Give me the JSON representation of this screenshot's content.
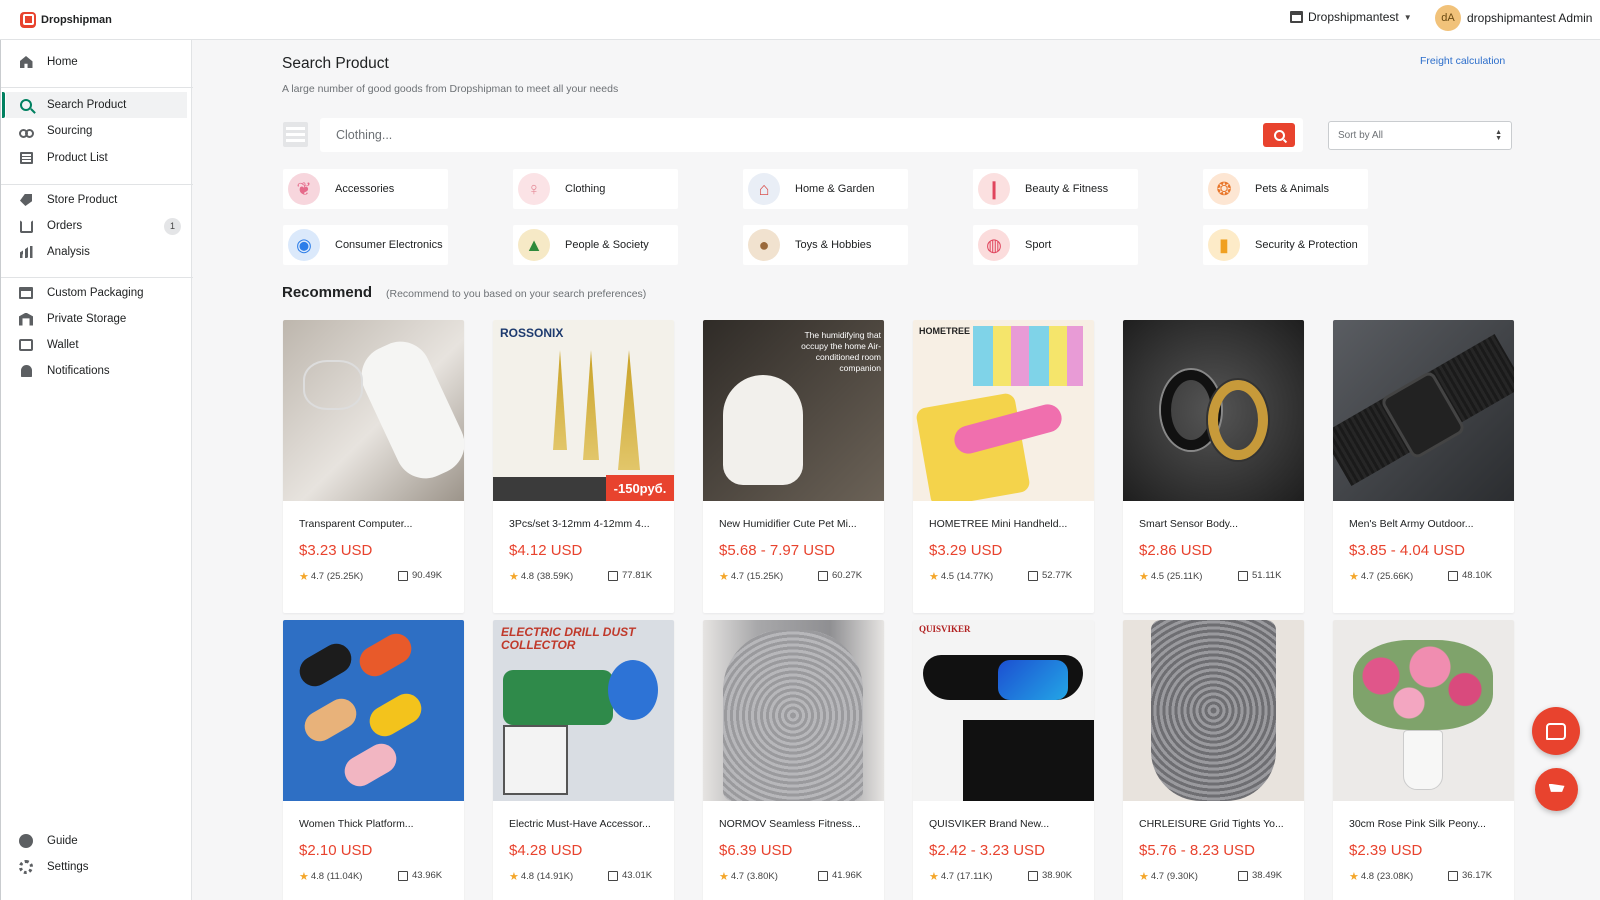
{
  "app": {
    "logo_text": "Dropshipman"
  },
  "header": {
    "store_name": "Dropshipmantest",
    "avatar_initials": "dA",
    "user_name": "dropshipmantest Admin"
  },
  "sidebar": {
    "items": [
      {
        "key": "home",
        "label": "Home",
        "icon": "home-icon"
      },
      {
        "key": "search",
        "label": "Search Product",
        "icon": "search-icon",
        "active": true
      },
      {
        "key": "sourcing",
        "label": "Sourcing",
        "icon": "glasses-icon"
      },
      {
        "key": "productlist",
        "label": "Product List",
        "icon": "list-icon"
      },
      {
        "key": "store",
        "label": "Store Product",
        "icon": "tag-icon"
      },
      {
        "key": "orders",
        "label": "Orders",
        "icon": "orders-icon",
        "badge": "1"
      },
      {
        "key": "analysis",
        "label": "Analysis",
        "icon": "bar-chart-icon"
      },
      {
        "key": "packaging",
        "label": "Custom Packaging",
        "icon": "box-icon"
      },
      {
        "key": "storage",
        "label": "Private Storage",
        "icon": "warehouse-icon"
      },
      {
        "key": "wallet",
        "label": "Wallet",
        "icon": "wallet-icon"
      },
      {
        "key": "notifications",
        "label": "Notifications",
        "icon": "bell-icon"
      },
      {
        "key": "guide",
        "label": "Guide",
        "icon": "chat-icon"
      },
      {
        "key": "settings",
        "label": "Settings",
        "icon": "gear-icon"
      }
    ]
  },
  "main": {
    "title": "Search Product",
    "subtitle": "A large number of good goods from Dropshipman to meet all your needs",
    "freight_link": "Freight calculation",
    "search": {
      "placeholder": "Clothing..."
    },
    "sort": {
      "selected": "Sort by All"
    },
    "categories": [
      {
        "label": "Accessories",
        "icon": "ring-icon",
        "color": "#f7d6dd"
      },
      {
        "label": "Clothing",
        "icon": "dress-icon",
        "color": "#fbe3e6"
      },
      {
        "label": "Home & Garden",
        "icon": "sofa-icon",
        "color": "#e9eef6"
      },
      {
        "label": "Beauty & Fitness",
        "icon": "lipstick-icon",
        "color": "#fbe0e0"
      },
      {
        "label": "Pets & Animals",
        "icon": "dog-icon",
        "color": "#fde6d3"
      },
      {
        "label": "Consumer Electronics",
        "icon": "camera-icon",
        "color": "#dbe9fb"
      },
      {
        "label": "People & Society",
        "icon": "tree-icon",
        "color": "#f6e9c6"
      },
      {
        "label": "Toys & Hobbies",
        "icon": "teddy-bear-icon",
        "color": "#f1e2cf"
      },
      {
        "label": "Sport",
        "icon": "ball-icon",
        "color": "#fbdcdc"
      },
      {
        "label": "Security & Protection",
        "icon": "vest-icon",
        "color": "#fdebc8"
      }
    ],
    "recommend_title": "Recommend",
    "recommend_subtitle": "(Recommend to you based on your search preferences)",
    "products": [
      {
        "name": "Transparent Computer...",
        "price": "$3.23 USD",
        "rating": "4.7 (25.25K)",
        "sold": "90.49K",
        "bg": "#cfcac4"
      },
      {
        "name": "3Pcs/set 3-12mm 4-12mm 4...",
        "price": "$4.12 USD",
        "rating": "4.8 (38.59K)",
        "sold": "77.81K",
        "bg": "#f3f1ea",
        "brand": "ROSSONIX",
        "tag": "-150руб."
      },
      {
        "name": "New Humidifier Cute Pet Mi...",
        "price": "$5.68 - 7.97 USD",
        "rating": "4.7 (15.25K)",
        "sold": "60.27K",
        "bg": "#4a4540",
        "overlay": "The humidifying that occupy the home Air-conditioned room companion"
      },
      {
        "name": "HOMETREE Mini Handheld...",
        "price": "$3.29 USD",
        "rating": "4.5 (14.77K)",
        "sold": "52.77K",
        "bg": "#f7efe4",
        "brand": "HOMETREE"
      },
      {
        "name": "Smart Sensor Body...",
        "price": "$2.86 USD",
        "rating": "4.5 (25.11K)",
        "sold": "51.11K",
        "bg": "#2b2b2b"
      },
      {
        "name": "Men's Belt Army Outdoor...",
        "price": "$3.85 - 4.04 USD",
        "rating": "4.7 (25.66K)",
        "sold": "48.10K",
        "bg": "#3a3d42"
      },
      {
        "name": "Women Thick Platform...",
        "price": "$2.10 USD",
        "rating": "4.8 (11.04K)",
        "sold": "43.96K",
        "bg": "#2e6fc4"
      },
      {
        "name": "Electric Must-Have Accessor...",
        "price": "$4.28 USD",
        "rating": "4.8 (14.91K)",
        "sold": "43.01K",
        "bg": "#d9dde3",
        "brand": "ELECTRIC DRILL DUST COLLECTOR"
      },
      {
        "name": "NORMOV Seamless Fitness...",
        "price": "$6.39 USD",
        "rating": "4.7 (3.80K)",
        "sold": "41.96K",
        "bg": "#a9a9ab"
      },
      {
        "name": "QUISVIKER Brand New...",
        "price": "$2.42 - 3.23 USD",
        "rating": "4.7 (17.11K)",
        "sold": "38.90K",
        "bg": "#f4f4f4",
        "brand": "QUISVIKER"
      },
      {
        "name": "CHRLEISURE Grid Tights Yo...",
        "price": "$5.76 - 8.23 USD",
        "rating": "4.7 (9.30K)",
        "sold": "38.49K",
        "bg": "#c8c4c0"
      },
      {
        "name": "30cm Rose Pink Silk Peony...",
        "price": "$2.39 USD",
        "rating": "4.8 (23.08K)",
        "sold": "36.17K",
        "bg": "#eceae8"
      }
    ]
  },
  "fabs": {
    "chat": "chat-bubble-icon",
    "cart": "cart-icon"
  }
}
